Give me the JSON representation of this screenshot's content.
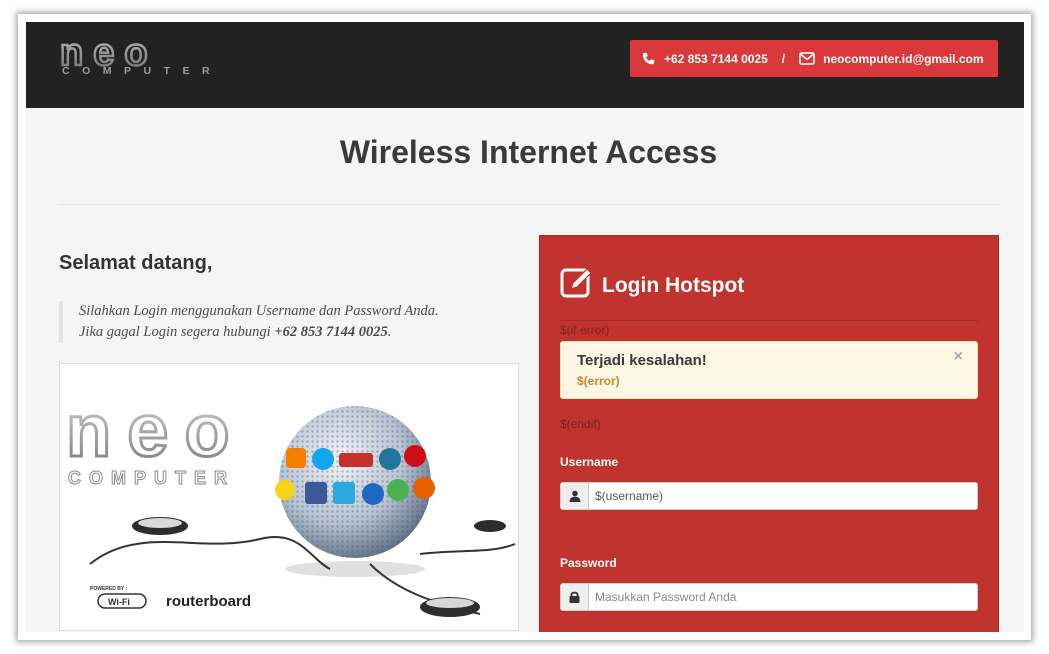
{
  "header": {
    "logo_text": "neo COMPUTER",
    "phone": "+62 853 7144 0025",
    "separator": "/",
    "email": "neocomputer.id@gmail.com"
  },
  "page": {
    "title": "Wireless Internet Access"
  },
  "intro": {
    "greeting": "Selamat datang,",
    "line1": "Silahkan Login menggunakan Username dan Password Anda.",
    "line2_prefix": "Jika gagal Login segera hubungi ",
    "line2_phone": "+62 853 7144 0025",
    "line2_suffix": "."
  },
  "hero": {
    "logo_text": "neo",
    "logo_sub": "COMPUTER",
    "powered_by": "POWERED BY :",
    "wifi_badge": "Wi-Fi",
    "routerboard": "routerboard"
  },
  "login": {
    "title": "Login Hotspot",
    "if_error": "$(if error)",
    "alert_title": "Terjadi kesalahan!",
    "alert_message": "$(error)",
    "alert_close": "×",
    "endif": "$(endif)",
    "username_label": "Username",
    "username_value": "$(username)",
    "password_label": "Password",
    "password_placeholder": "Masukkan Password Anda"
  },
  "colors": {
    "header_bg": "#222222",
    "accent_red": "#d9393b",
    "panel_red": "#c0332f",
    "alert_bg": "#fcf7e4"
  },
  "icons": [
    "phone-icon",
    "envelope-icon",
    "edit-icon",
    "user-icon",
    "lock-icon",
    "close-icon"
  ]
}
